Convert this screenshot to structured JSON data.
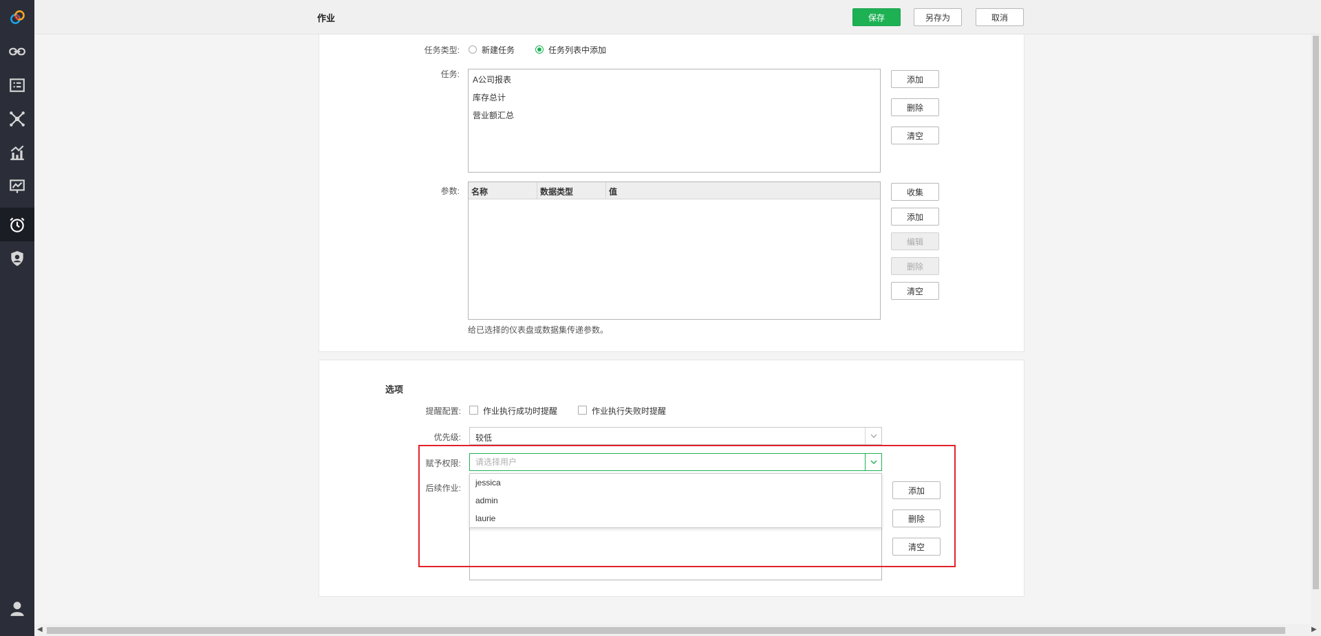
{
  "header": {
    "title": "作业",
    "save_label": "保存",
    "save_as_label": "另存为",
    "cancel_label": "取消"
  },
  "task_section": {
    "task_type_label": "任务类型:",
    "option_new": "新建任务",
    "option_from_list": "任务列表中添加",
    "selected_option": "任务列表中添加",
    "task_label": "任务:",
    "tasks": [
      "A公司报表",
      "库存总计",
      "营业额汇总"
    ],
    "task_buttons": {
      "add": "添加",
      "delete": "删除",
      "clear": "清空"
    },
    "params_label": "参数:",
    "params_columns": [
      "名称",
      "数据类型",
      "值"
    ],
    "params_buttons": {
      "collect": "收集",
      "add": "添加",
      "edit": "编辑",
      "delete": "删除",
      "clear": "清空"
    },
    "params_hint": "给已选择的仪表盘或数据集传递参数。"
  },
  "options_section": {
    "title": "选项",
    "reminder_label": "提醒配置:",
    "reminder_success": "作业执行成功时提醒",
    "reminder_failure": "作业执行失败时提醒",
    "priority_label": "优先级:",
    "priority_value": "较低",
    "permission_label": "赋予权限:",
    "permission_placeholder": "请选择用户",
    "user_options": [
      "jessica",
      "admin",
      "laurie"
    ],
    "followup_label": "后续作业:",
    "followup_buttons": {
      "add": "添加",
      "delete": "删除",
      "clear": "清空"
    }
  },
  "colors": {
    "accent": "#1db154",
    "highlight": "#e2212a",
    "nav_bg": "#2b2e38"
  }
}
